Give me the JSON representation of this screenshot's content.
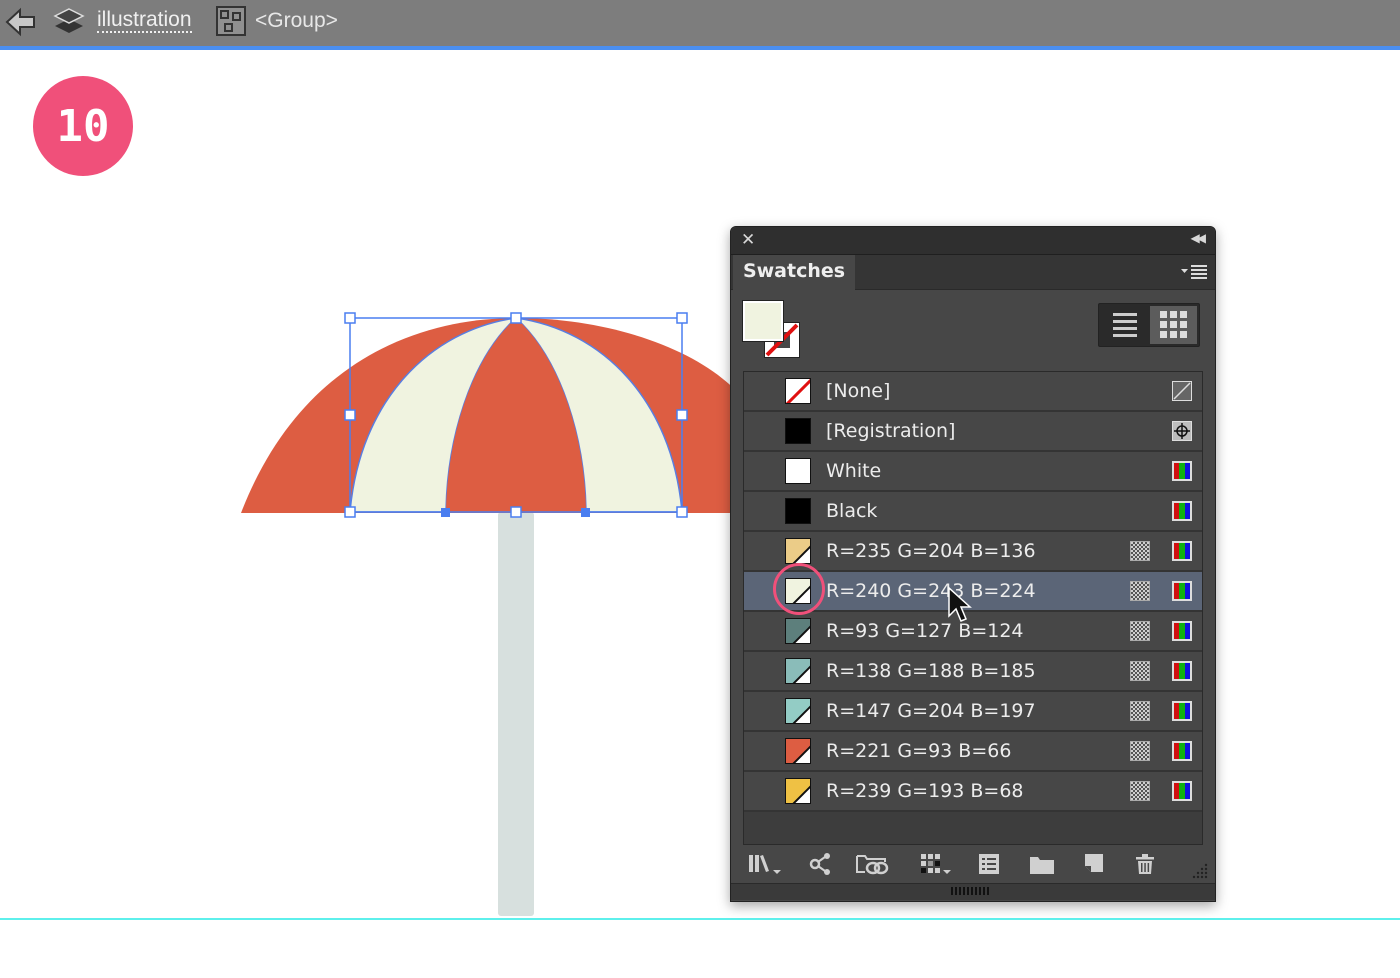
{
  "topbar": {
    "back_icon": "back-arrow-icon",
    "layers_icon": "layers-icon",
    "layer_name": "illustration",
    "group_icon": "group-icon",
    "group_label": "<Group>"
  },
  "step_badge": "10",
  "artwork": {
    "canopy_red": "#dd5d42",
    "canopy_cream": "#f0f3e0",
    "pole": "#d7e0de",
    "selection_color": "#4a7ef0",
    "guide_color": "#5ef0ec"
  },
  "panel": {
    "close_icon": "close-icon",
    "collapse_icon": "collapse-icon",
    "collapse_glyph": "◀◀",
    "close_glyph": "✕",
    "tab_label": "Swatches",
    "menu_icon": "panel-menu-icon",
    "fill_color": "#f0f3e0",
    "stroke": "none",
    "view_modes": [
      "list",
      "grid"
    ],
    "active_view": "grid",
    "swatches": [
      {
        "label": "[None]",
        "color": "none",
        "kind": "none",
        "global": false,
        "type_icon": "none-icon"
      },
      {
        "label": "[Registration]",
        "color": "#000000",
        "kind": "solid",
        "global": false,
        "type_icon": "registration-icon"
      },
      {
        "label": "White",
        "color": "#ffffff",
        "kind": "solid",
        "global": false,
        "type_icon": "rgb-icon"
      },
      {
        "label": "Black",
        "color": "#000000",
        "kind": "solid",
        "global": false,
        "type_icon": "rgb-icon"
      },
      {
        "label": "R=235 G=204 B=136",
        "color": "#ebcc88",
        "kind": "global",
        "global": true,
        "type_icon": "rgb-icon"
      },
      {
        "label": "R=240 G=243 B=224",
        "color": "#f0f3e0",
        "kind": "global",
        "global": true,
        "type_icon": "rgb-icon",
        "selected": true
      },
      {
        "label": "R=93 G=127 B=124",
        "color": "#5d7f7c",
        "kind": "global",
        "global": true,
        "type_icon": "rgb-icon"
      },
      {
        "label": "R=138 G=188 B=185",
        "color": "#8abcb9",
        "kind": "global",
        "global": true,
        "type_icon": "rgb-icon"
      },
      {
        "label": "R=147 G=204 B=197",
        "color": "#93ccc5",
        "kind": "global",
        "global": true,
        "type_icon": "rgb-icon"
      },
      {
        "label": "R=221 G=93 B=66",
        "color": "#dd5d42",
        "kind": "global",
        "global": true,
        "type_icon": "rgb-icon"
      },
      {
        "label": "R=239 G=193 B=68",
        "color": "#efc144",
        "kind": "global",
        "global": true,
        "type_icon": "rgb-icon"
      }
    ],
    "footer_icons": [
      "swatch-libraries-menu-icon",
      "share-icon",
      "cc-libraries-icon",
      "show-swatch-kinds-menu-icon",
      "swatch-options-icon",
      "new-color-group-icon",
      "new-swatch-icon",
      "delete-swatch-icon"
    ]
  }
}
